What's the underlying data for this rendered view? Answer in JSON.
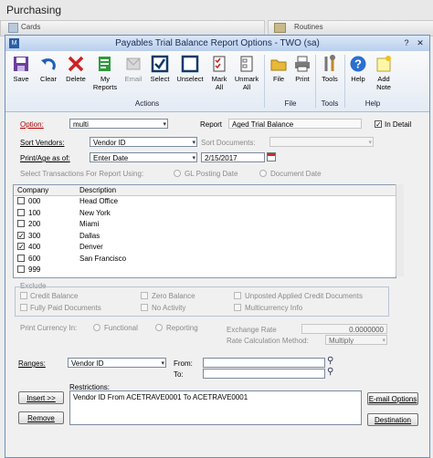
{
  "app": {
    "title": "Purchasing",
    "tabs": [
      {
        "label": "Cards"
      },
      {
        "label": "Routines"
      }
    ]
  },
  "window": {
    "title": "Payables Trial Balance Report Options  -  TWO (sa)",
    "help_glyph": "?",
    "close_glyph": "✕"
  },
  "toolbar": {
    "save": "Save",
    "clear": "Clear",
    "delete": "Delete",
    "my_reports": "My Reports",
    "email": "Email",
    "select": "Select",
    "unselect": "Unselect",
    "mark_all": "Mark All",
    "unmark_all": "Unmark All",
    "file": "File",
    "print": "Print",
    "tools": "Tools",
    "help": "Help",
    "add_note": "Add Note",
    "groups": {
      "actions": "Actions",
      "file": "File",
      "tools": "Tools",
      "help": "Help"
    }
  },
  "form": {
    "option_label": "Option:",
    "option_value": "multi",
    "report_label": "Report",
    "report_value": "Aged Trial Balance",
    "in_detail_label": "In Detail",
    "in_detail_checked": true,
    "sort_vendors_label": "Sort Vendors:",
    "sort_vendors_value": "Vendor ID",
    "sort_documents_label": "Sort Documents:",
    "sort_documents_value": "",
    "print_age_label": "Print/Age as of:",
    "print_age_value": "Enter Date",
    "date_value": "2/15/2017",
    "select_trans_label": "Select Transactions For Report Using:",
    "gl_posting": "GL Posting Date",
    "document_date": "Document Date"
  },
  "companies": {
    "header_company": "Company",
    "header_description": "Description",
    "rows": [
      {
        "code": "000",
        "description": "Head Office",
        "checked": false
      },
      {
        "code": "100",
        "description": "New York",
        "checked": false
      },
      {
        "code": "200",
        "description": "Miami",
        "checked": false
      },
      {
        "code": "300",
        "description": "Dallas",
        "checked": true
      },
      {
        "code": "400",
        "description": "Denver",
        "checked": true
      },
      {
        "code": "600",
        "description": "San Francisco",
        "checked": false
      },
      {
        "code": "999",
        "description": "",
        "checked": false
      }
    ]
  },
  "exclude": {
    "title": "Exclude",
    "credit_balance": "Credit Balance",
    "zero_balance": "Zero Balance",
    "unposted": "Unposted Applied Credit Documents",
    "fully_paid": "Fully Paid Documents",
    "no_activity": "No Activity",
    "multicurrency": "Multicurrency Info"
  },
  "currency": {
    "print_currency_label": "Print Currency In:",
    "functional": "Functional",
    "reporting": "Reporting",
    "exchange_rate_label": "Exchange Rate",
    "exchange_rate_value": "0.0000000",
    "rate_calc_label": "Rate Calculation Method:",
    "rate_calc_value": "Multiply"
  },
  "ranges": {
    "label": "Ranges:",
    "value": "Vendor ID",
    "from_label": "From:",
    "to_label": "To:",
    "restrictions_label": "Restrictions:",
    "restrictions": [
      "Vendor ID From ACETRAVE0001 To ACETRAVE0001"
    ]
  },
  "buttons": {
    "insert": "Insert >>",
    "remove": "Remove",
    "email_options": "E-mail Options",
    "destination": "Destination"
  }
}
